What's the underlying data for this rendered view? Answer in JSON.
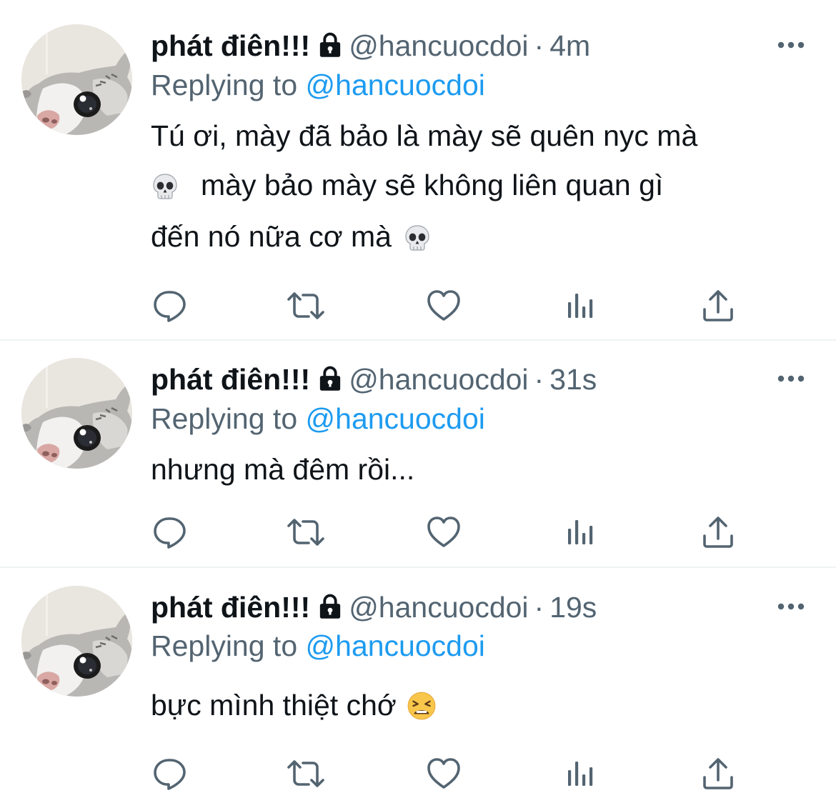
{
  "colors": {
    "text": "#0f1419",
    "secondary": "#536471",
    "link": "#1d9bf0",
    "divider": "#eff3f4"
  },
  "tweets": [
    {
      "display_name": "phát điên!!!",
      "handle": "@hancuocdoi",
      "separator": "·",
      "time": "4m",
      "replying_prefix": "Replying to",
      "replying_handle": "@hancuocdoi",
      "lines": [
        "Tú ơi, mày đã bảo là mày sẽ quên nyc mà",
        "mày bảo mày sẽ không liên quan gì",
        "đến nó nữa cơ mà"
      ],
      "icons": [
        "lock-icon",
        "more-icon",
        "skull-emoji",
        "reply-icon",
        "retweet-icon",
        "like-icon",
        "views-icon",
        "share-icon"
      ]
    },
    {
      "display_name": "phát điên!!!",
      "handle": "@hancuocdoi",
      "separator": "·",
      "time": "31s",
      "replying_prefix": "Replying to",
      "replying_handle": "@hancuocdoi",
      "lines": [
        "nhưng mà đêm rồi..."
      ],
      "icons": [
        "lock-icon",
        "more-icon",
        "reply-icon",
        "retweet-icon",
        "like-icon",
        "views-icon",
        "share-icon"
      ]
    },
    {
      "display_name": "phát điên!!!",
      "handle": "@hancuocdoi",
      "separator": "·",
      "time": "19s",
      "replying_prefix": "Replying to",
      "replying_handle": "@hancuocdoi",
      "lines": [
        "bực mình thiệt chớ"
      ],
      "icons": [
        "lock-icon",
        "more-icon",
        "tired-face-emoji",
        "reply-icon",
        "retweet-icon",
        "like-icon",
        "views-icon",
        "share-icon"
      ]
    }
  ]
}
